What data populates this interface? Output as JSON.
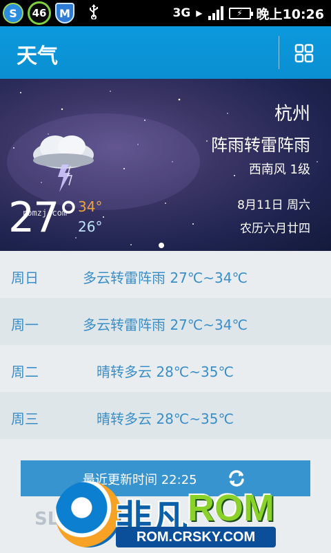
{
  "statusbar": {
    "icon_s": "S",
    "badge_number": "46",
    "shield_letter": "M",
    "usb_icon": "usb-icon",
    "network": "3G",
    "time": "晚上10:26"
  },
  "appbar": {
    "title": "天气",
    "grid_icon": "grid-icon"
  },
  "hero": {
    "city": "杭州",
    "condition": "阵雨转雷阵雨",
    "wind": "西南风 1级",
    "date": "8月11日 周六",
    "lunar": "农历六月廿四",
    "temp_now": "27°",
    "temp_high": "34°",
    "temp_low": "26°",
    "watermark": "romzj.com",
    "weather_icon": "thunderstorm-cloud-icon"
  },
  "forecast": [
    {
      "day": "周日",
      "desc": "多云转雷阵雨 27℃~34℃"
    },
    {
      "day": "周一",
      "desc": "多云转雷阵雨 27℃~34℃"
    },
    {
      "day": "周二",
      "desc": "晴转多云 28℃~35℃"
    },
    {
      "day": "周三",
      "desc": "晴转多云 28℃~35℃"
    }
  ],
  "update": {
    "label": "最近更新时间 22:25",
    "icon": "refresh-icon"
  },
  "logo": {
    "fei": "非凡",
    "rom": "ROM",
    "url": "ROM.CRSKY.COM",
    "prefix": "SL"
  },
  "colors": {
    "accent": "#0a93d6",
    "forecast_text": "#3a8ec7",
    "high_temp": "#f0a33a",
    "low_temp": "#bfe3ff"
  }
}
